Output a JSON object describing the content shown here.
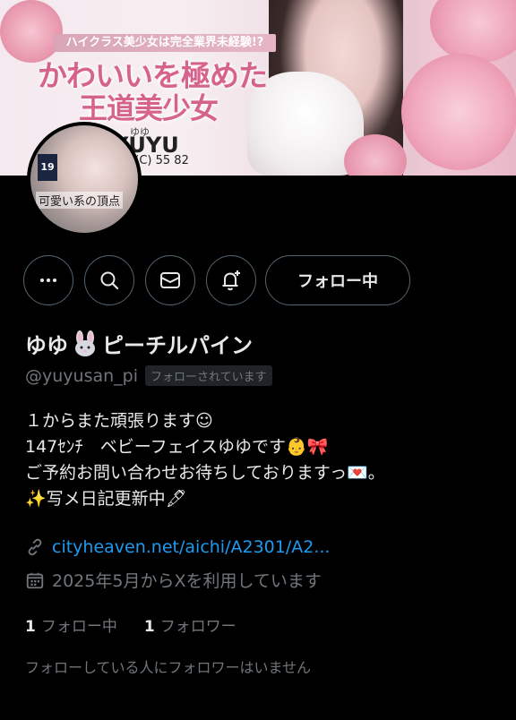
{
  "banner": {
    "kicker": "ハイクラス美少女は完全業界未経験!?",
    "title_line1": "かわいいを極めた",
    "title_line2": "王道美少女",
    "name_ruby": "ゆゆ",
    "name_roman": "YUYU",
    "measurements": "8(C) 55 82"
  },
  "avatar": {
    "age_badge": "19",
    "caption": "可愛い系の頂点"
  },
  "actions": {
    "follow_label": "フォロー中"
  },
  "profile": {
    "display_name_prefix": "ゆゆ",
    "display_name_suffix": "ピーチルパイン",
    "handle": "@yuyusan_pi",
    "follows_you": "フォローされています",
    "bio_lines": [
      "１からまた頑張ります☺",
      "147ｾﾝﾁ　ベビーフェイスゆゆです👶🎀",
      "ご予約お問い合わせお待ちしておりますっ💌。",
      "✨写メ日記更新中🖋"
    ],
    "link": "cityheaven.net/aichi/A2301/A2...",
    "joined": "2025年5月からXを利用しています"
  },
  "stats": {
    "following_count": "1",
    "following_label": "フォロー中",
    "followers_count": "1",
    "followers_label": "フォロワー"
  },
  "footnote": "フォローしている人にフォロワーはいません",
  "colors": {
    "background": "#000000",
    "text": "#e7e9ea",
    "muted": "#71767b",
    "link": "#1d9bf0",
    "banner_accent": "#d5638b"
  }
}
